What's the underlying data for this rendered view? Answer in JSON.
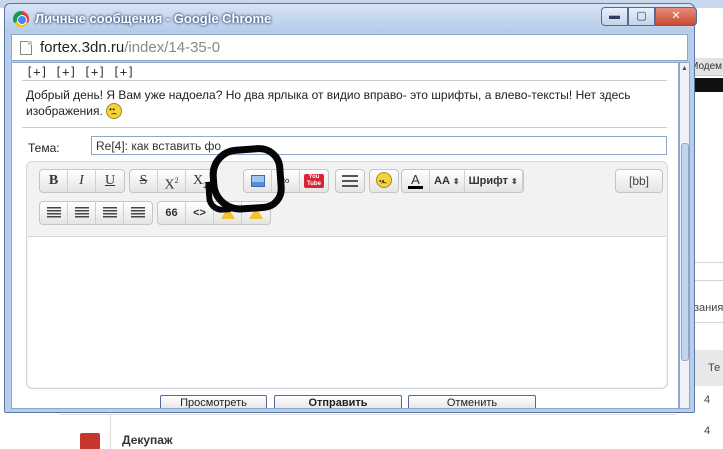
{
  "window": {
    "title": "Личные сообщения - Google Chrome",
    "controls": {
      "minimize": "▬",
      "maximize": "▢",
      "close": "✕"
    }
  },
  "address": {
    "domain": "fortex.3dn.ru",
    "path": "/index/14-35-0"
  },
  "message": {
    "expand_links": "[+] [+] [+] [+]",
    "text": "Добрый день! Я Вам уже надоела? Но два ярлыка от видио вправо- это шрифты, а влево-тексты! Нет здесь изображения."
  },
  "subject": {
    "label": "Тема:",
    "value": "Re[4]: как вставить фо"
  },
  "toolbar": {
    "bold": "B",
    "italic": "I",
    "underline": "U",
    "strike": "S",
    "sup_base": "X",
    "sup": "2",
    "sub_base": "X",
    "sub": "2",
    "youtube": "You Tube",
    "color": "A",
    "size_label": "AA",
    "font_label": "Шрифт",
    "bb": "[bb]",
    "quote": "66",
    "code": "<>"
  },
  "buttons": {
    "preview": "Просмотреть",
    "send": "Отправить",
    "cancel": "Отменить"
  },
  "background": {
    "right_header": "Модем",
    "right_text1": "зания(",
    "right_text2": "Те",
    "right_num1": "4",
    "right_num2": "4",
    "right_num3": "4",
    "forum_title": "Декупаж"
  }
}
